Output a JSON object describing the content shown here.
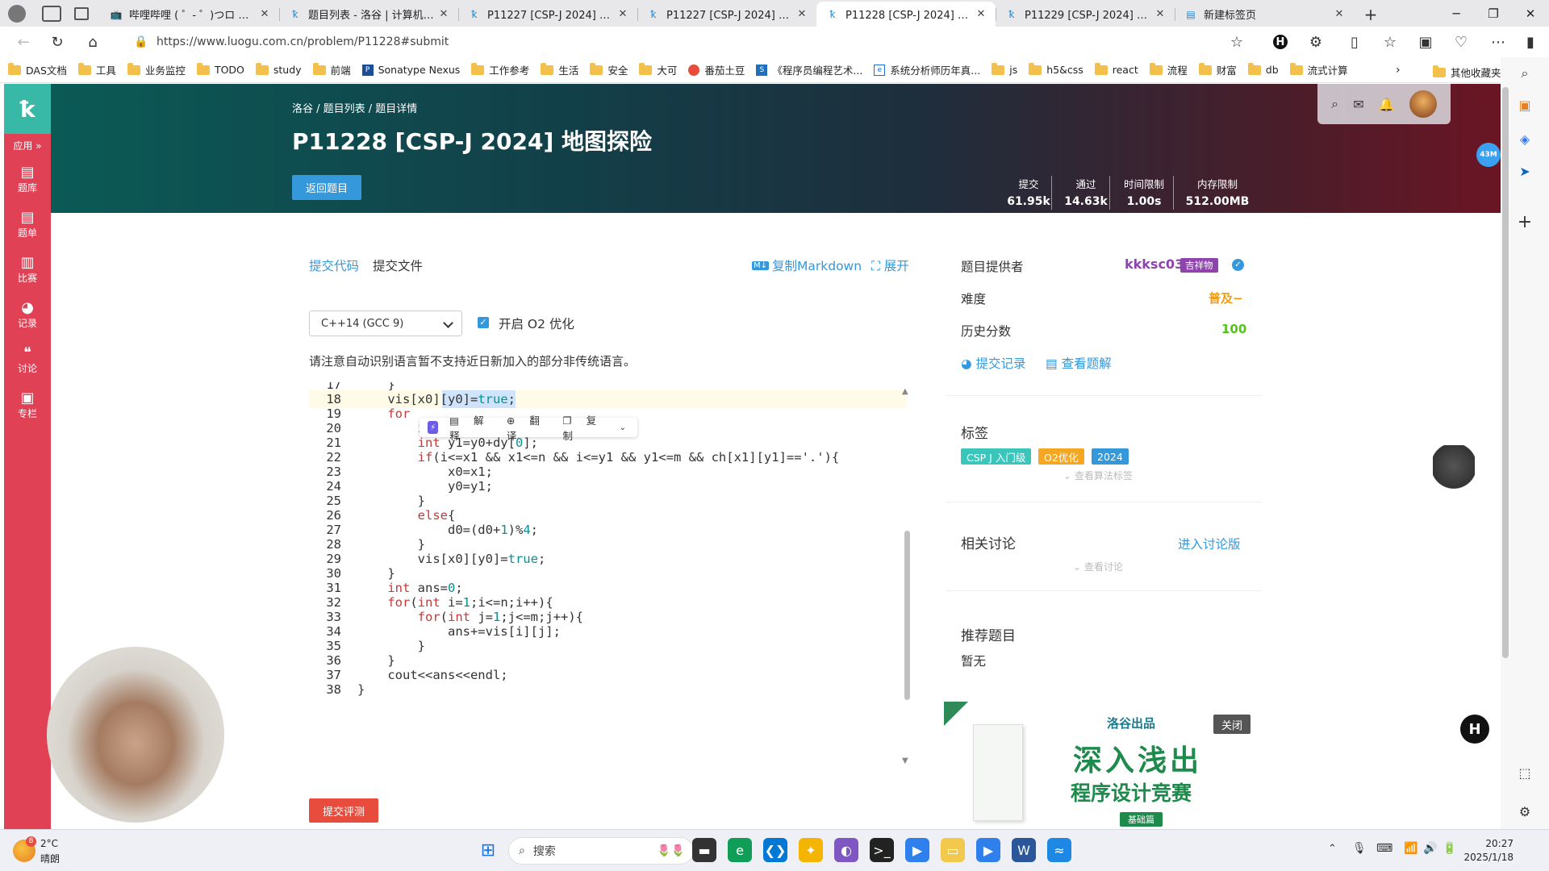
{
  "browser": {
    "tabs": [
      {
        "title": "哔哩哔哩 ( ゜- ゜)つロ 干杯~-b",
        "icon": "tv"
      },
      {
        "title": "题目列表 - 洛谷 | 计算机科学教",
        "icon": "luogu"
      },
      {
        "title": "P11227 [CSP-J 2024] 扑克牌 -",
        "icon": "luogu"
      },
      {
        "title": "P11227 [CSP-J 2024] 扑克牌 -",
        "icon": "luogu"
      },
      {
        "title": "P11228 [CSP-J 2024] 地图探险",
        "icon": "luogu",
        "active": true
      },
      {
        "title": "P11229 [CSP-J 2024] 小木棍 -",
        "icon": "luogu"
      },
      {
        "title": "新建标签页",
        "icon": "newtab"
      }
    ],
    "url": "https://www.luogu.com.cn/problem/P11228#submit",
    "bookmarks": [
      "DAS文档",
      "工具",
      "业务监控",
      "TODO",
      "study",
      "前端",
      "Sonatype Nexus",
      "工作参考",
      "生活",
      "安全",
      "大可",
      "番茄土豆",
      "《程序员编程艺术...",
      "系统分析师历年真...",
      "js",
      "h5&css",
      "react",
      "流程",
      "财富",
      "db",
      "流式计算"
    ],
    "other_bookmarks": "其他收藏夹"
  },
  "sidebar": {
    "apps_label": "应用 »",
    "items": [
      {
        "label": "题库",
        "icon": "problem-set-icon"
      },
      {
        "label": "题单",
        "icon": "training-icon"
      },
      {
        "label": "比赛",
        "icon": "contest-icon"
      },
      {
        "label": "记录",
        "icon": "record-icon"
      },
      {
        "label": "讨论",
        "icon": "discuss-icon"
      },
      {
        "label": "专栏",
        "icon": "article-icon"
      }
    ]
  },
  "header": {
    "breadcrumb": "洛谷 / 题目列表 / 题目详情",
    "title": "P11228 [CSP-J 2024] 地图探险",
    "back_button": "返回题目",
    "stats": [
      {
        "label": "提交",
        "value": "61.95k"
      },
      {
        "label": "通过",
        "value": "14.63k"
      },
      {
        "label": "时间限制",
        "value": "1.00s"
      },
      {
        "label": "内存限制",
        "value": "512.00MB"
      }
    ]
  },
  "submit": {
    "tab_code": "提交代码",
    "tab_file": "提交文件",
    "copy_markdown": "复制Markdown",
    "expand": "展开",
    "language": "C++14 (GCC 9)",
    "o2_label": "开启 O2 优化",
    "o2_checked": true,
    "notice": "请注意自动识别语言暂不支持近日新加入的部分非传统语言。",
    "submit_button": "提交评测"
  },
  "code_lines": [
    {
      "n": "17",
      "t": "    }"
    },
    {
      "n": "18",
      "t": "    vis[x0][y0]=true;"
    },
    {
      "n": "19",
      "t": "    for"
    },
    {
      "n": "20",
      "t": "        int x1=x0+dx[0];"
    },
    {
      "n": "21",
      "t": "        int y1=y0+dy[0];"
    },
    {
      "n": "22",
      "t": "        if(i<=x1 && x1<=n && i<=y1 && y1<=m && ch[x1][y1]=='.'){"
    },
    {
      "n": "23",
      "t": "            x0=x1;"
    },
    {
      "n": "24",
      "t": "            y0=y1;"
    },
    {
      "n": "25",
      "t": "        }"
    },
    {
      "n": "26",
      "t": "        else{"
    },
    {
      "n": "27",
      "t": "            d0=(d0+1)%4;"
    },
    {
      "n": "28",
      "t": "        }"
    },
    {
      "n": "29",
      "t": "        vis[x0][y0]=true;"
    },
    {
      "n": "30",
      "t": "    }"
    },
    {
      "n": "31",
      "t": "    int ans=0;"
    },
    {
      "n": "32",
      "t": "    for(int i=1;i<=n;i++){"
    },
    {
      "n": "33",
      "t": "        for(int j=1;j<=m;j++){"
    },
    {
      "n": "34",
      "t": "            ans+=vis[i][j];"
    },
    {
      "n": "35",
      "t": "        }"
    },
    {
      "n": "36",
      "t": "    }"
    },
    {
      "n": "37",
      "t": "    cout<<ans<<endl;"
    },
    {
      "n": "38",
      "t": "}"
    }
  ],
  "selection_popup": [
    "解释",
    "翻译",
    "复制"
  ],
  "problem_info": {
    "provider_label": "题目提供者",
    "provider": "kkksc03",
    "provider_badge": "吉祥物",
    "difficulty_label": "难度",
    "difficulty": "普及−",
    "history_label": "历史分数",
    "history_score": "100",
    "submissions_link": "提交记录",
    "solutions_link": "查看题解"
  },
  "tags_section": {
    "title": "标签",
    "tags": [
      {
        "text": "CSP J 入门级",
        "color": "#3bc6bc"
      },
      {
        "text": "O2优化",
        "color": "#f5a623"
      },
      {
        "text": "2024",
        "color": "#3498db"
      }
    ],
    "show_algo_tags": "查看算法标签"
  },
  "discussion": {
    "title": "相关讨论",
    "enter_link": "进入讨论版",
    "show": "查看讨论"
  },
  "recommended": {
    "title": "推荐题目",
    "empty": "暂无"
  },
  "ad": {
    "brand": "洛谷出品",
    "headline1": "深入浅出",
    "headline2": "程序设计竞赛",
    "edition": "基础篇",
    "close": "关闭"
  },
  "taskbar": {
    "temperature": "2°C",
    "weather": "晴朗",
    "weather_badge": "8",
    "search_placeholder": "搜索",
    "time": "20:27",
    "date": "2025/1/18"
  },
  "float_badge": "43M"
}
